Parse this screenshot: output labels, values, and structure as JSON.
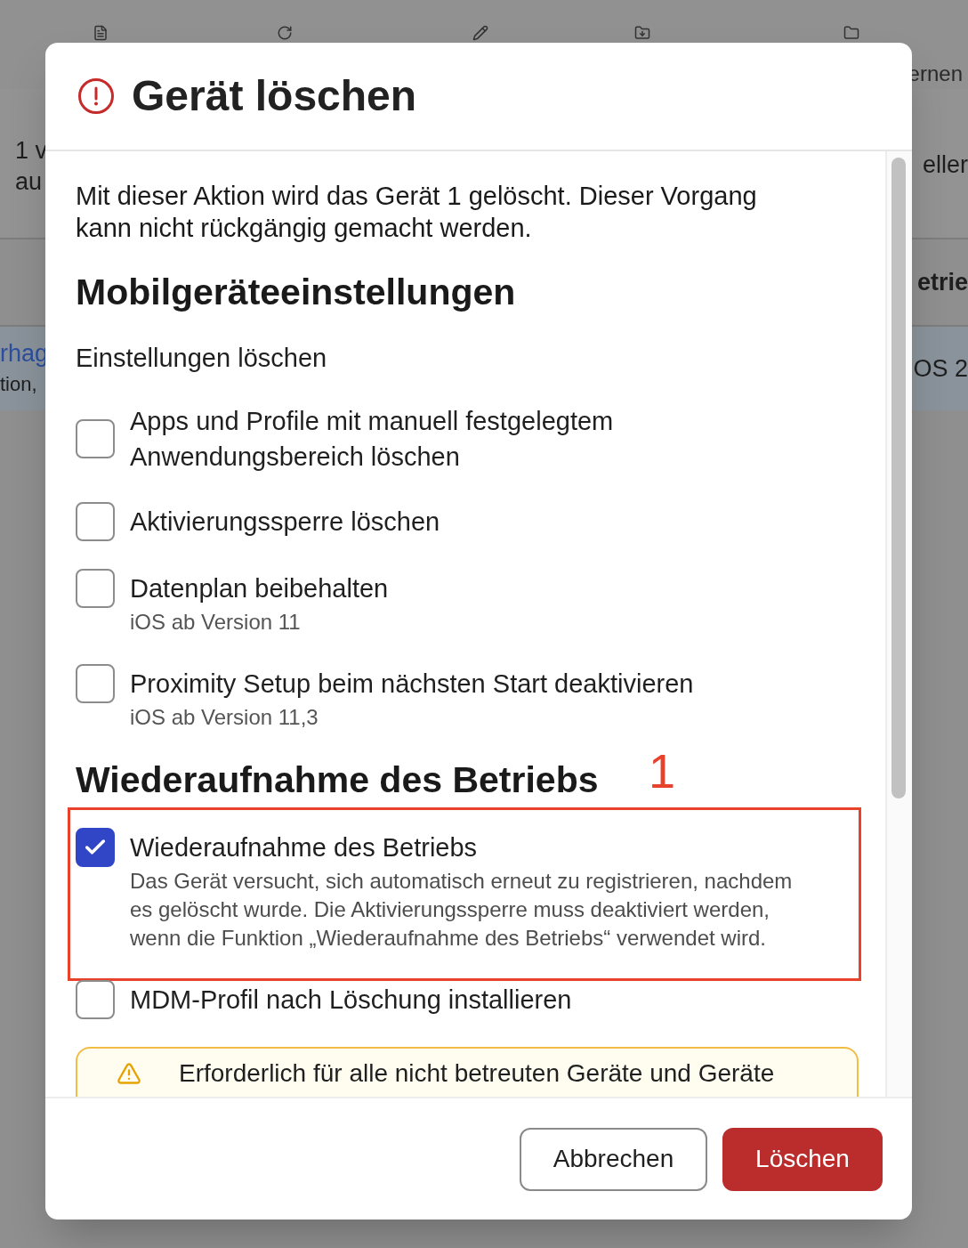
{
  "background_page": {
    "toolbar_label": "ernen",
    "summary_left": [
      "1 v",
      "au"
    ],
    "summary_right": "eller",
    "table_header_right": "etrie",
    "row": {
      "selected": true,
      "link": "rhag",
      "detail": "tion,",
      "cell_right": "OS 2"
    }
  },
  "dialog": {
    "title": "Gerät löschen",
    "message": "Mit dieser Aktion wird das Gerät 1 gelöscht. Dieser Vorgang kann nicht rückgängig gemacht werden.",
    "sections": [
      {
        "heading": "Mobilgeräteeinstellungen",
        "subheading": "Einstellungen löschen",
        "options": [
          {
            "label": "Apps und Profile mit manuell festgelegtem Anwendungsbereich löschen",
            "checked": false
          },
          {
            "label": "Aktivierungssperre löschen",
            "checked": false
          },
          {
            "label": "Datenplan beibehalten",
            "hint": "iOS ab Version 11",
            "checked": false
          },
          {
            "label": "Proximity Setup beim nächsten Start deaktivieren",
            "hint": "iOS ab Version 11,3",
            "checked": false
          }
        ]
      },
      {
        "heading": "Wiederaufnahme des Betriebs",
        "options": [
          {
            "label": "Wiederaufnahme des Betriebs",
            "description": "Das Gerät versucht, sich automatisch erneut zu registrieren, nachdem es gelöscht wurde. Die Aktivierungssperre muss deaktiviert werden, wenn die Funktion „Wiederaufnahme des Betriebs“ verwendet wird.",
            "checked": true,
            "annotation": "1"
          },
          {
            "label": "MDM-Profil nach Löschung installieren",
            "checked": false
          }
        ],
        "notice": {
          "kind": "warning",
          "text": "Erforderlich für alle nicht betreuten Geräte und Geräte"
        }
      }
    ],
    "buttons": [
      {
        "label": "Abbrechen",
        "kind": "secondary"
      },
      {
        "label": "Löschen",
        "kind": "danger"
      }
    ]
  }
}
